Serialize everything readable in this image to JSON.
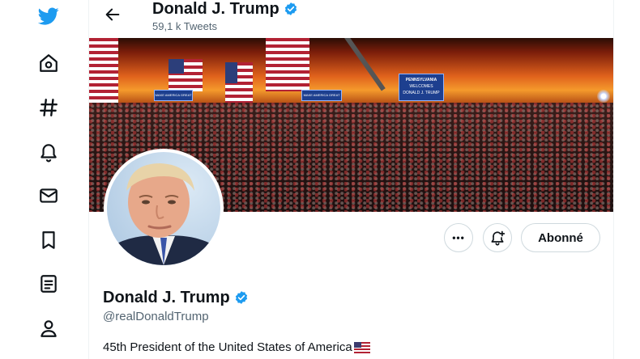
{
  "header": {
    "name": "Donald J. Trump",
    "tweet_count": "59,1 k Tweets"
  },
  "nav": {
    "items": [
      "twitter-logo",
      "home-icon",
      "explore-icon",
      "notifications-icon",
      "messages-icon",
      "bookmarks-icon",
      "lists-icon",
      "profile-icon"
    ]
  },
  "banner": {
    "sign_line1": "PENNSYLVANIA",
    "sign_line2": "WELCOMES",
    "sign_line3": "DONALD J. TRUMP",
    "banner_text_left": "MAKE AMERICA GREAT AGAIN",
    "banner_text_mid": "MAKE AMERICA GREAT AGAIN"
  },
  "actions": {
    "more_label": "•••",
    "follow_label": "Abonné"
  },
  "profile": {
    "name": "Donald J. Trump",
    "handle": "@realDonaldTrump",
    "bio": "45th President of the United States of America"
  },
  "colors": {
    "twitter_blue": "#1d9bf0",
    "text": "#0f1419",
    "secondary": "#536471",
    "border": "#cfd9de"
  }
}
